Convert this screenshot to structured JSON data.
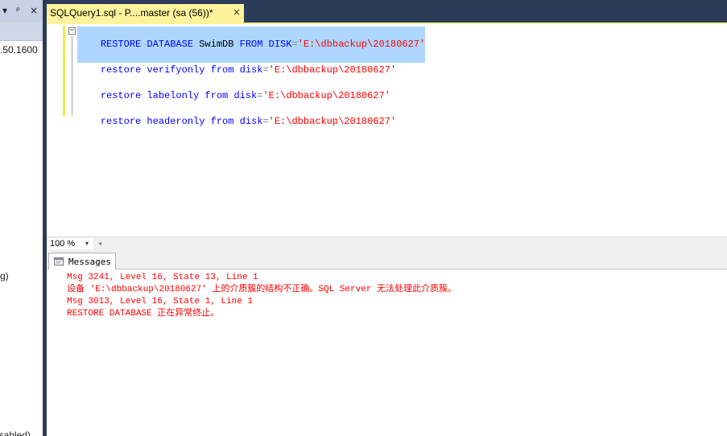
{
  "left_panel": {
    "header_buttons": [
      "▾",
      "ᵖ",
      "×"
    ],
    "server_version_fragment": ".50.1600",
    "partial_item_1": "g)",
    "partial_item_2": "isabled)"
  },
  "document_tab": {
    "title": "SQLQuery1.sql - P....master (sa (56))*",
    "close_glyph": "×"
  },
  "editor": {
    "collapse_glyph": "−",
    "lines": [
      {
        "kw1": "RESTORE DATABASE",
        "ident": " SwimDB ",
        "kw2": "FROM",
        "kw3": " DISK",
        "op": "=",
        "str": "'E:\\dbbackup\\20180627'"
      },
      {
        "kw1": "restore verifyonly from",
        "kw3": " disk",
        "op": "=",
        "str": "'E:\\dbbackup\\20180627'"
      },
      {
        "kw1": "restore labelonly from",
        "kw3": " disk",
        "op": "=",
        "str": "'E:\\dbbackup\\20180627'"
      },
      {
        "kw1": "restore headeronly from",
        "kw3": " disk",
        "op": "=",
        "str": "'E:\\dbbackup\\20180627'"
      }
    ]
  },
  "zoom": {
    "value": "100 %",
    "dropdown_glyph": "▾",
    "scroll_left_glyph": "◂"
  },
  "results": {
    "tab_label": "Messages",
    "messages": [
      "Msg 3241, Level 16, State 13, Line 1",
      "设备 'E:\\dbbackup\\20180627' 上的介质簇的结构不正确。SQL Server 无法处理此介质簇。",
      "Msg 3013, Level 16, State 1, Line 1",
      "RESTORE DATABASE 正在异常终止。"
    ]
  },
  "colors": {
    "chrome": "#2b3c59",
    "tab_active": "#fff29d",
    "keyword": "#0000ff",
    "string": "#ff0000",
    "selection": "#add6ff",
    "error": "#ff0000"
  }
}
